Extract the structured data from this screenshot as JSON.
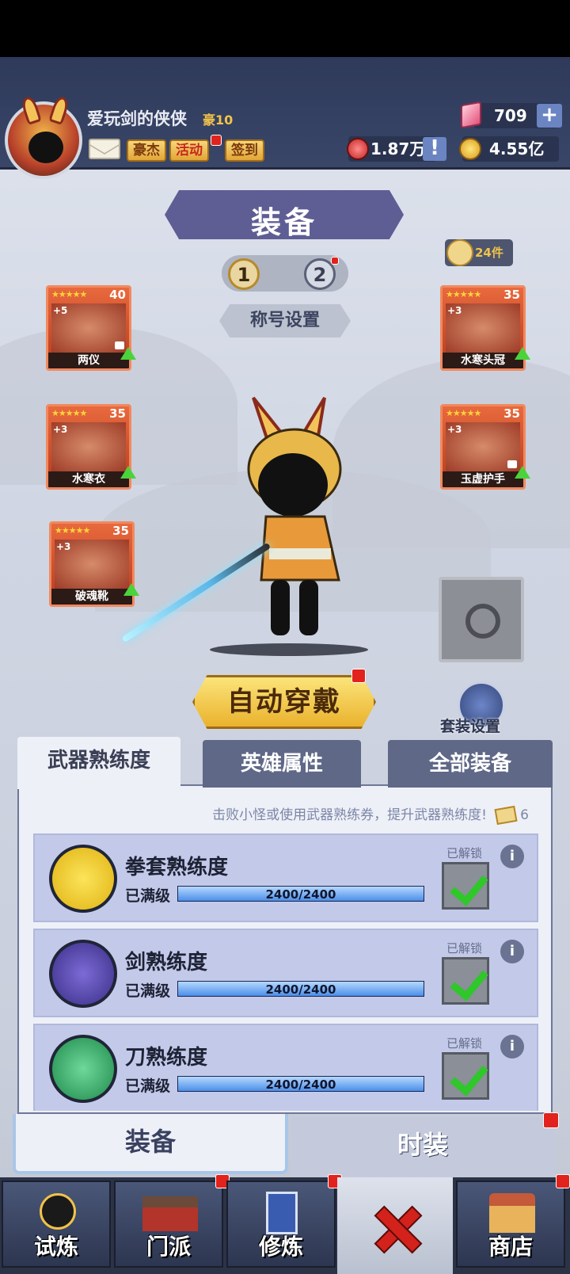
{
  "header": {
    "player_name": "爱玩剑的侠侠",
    "vip_label": "豪10",
    "buttons": [
      "豪杰",
      "活动",
      "签到"
    ],
    "gems": "709",
    "vouchers": "1.87万",
    "coins": "4.55亿",
    "plus_symbol": "+",
    "exclaim_symbol": "!"
  },
  "title": "装备",
  "pager": [
    "1",
    "2"
  ],
  "item_count": "24件",
  "title_setting": "称号设置",
  "slots": [
    {
      "name": "两仪",
      "stars": "★★★★★",
      "level": "40",
      "plus": "+5"
    },
    {
      "name": "水寒衣",
      "stars": "★★★★★",
      "level": "35",
      "plus": "+3"
    },
    {
      "name": "破魂靴",
      "stars": "★★★★★",
      "level": "35",
      "plus": "+3"
    },
    {
      "name": "水寒头冠",
      "stars": "★★★★★",
      "level": "35",
      "plus": "+3"
    },
    {
      "name": "玉虚护手",
      "stars": "★★★★★",
      "level": "35",
      "plus": "+3"
    }
  ],
  "auto_equip": "自动穿戴",
  "suit_setting": "套装设置",
  "panel": {
    "tabs": [
      "武器熟练度",
      "英雄属性",
      "全部装备"
    ],
    "hint": "击败小怪或使用武器熟练券，提升武器熟练度!",
    "ticket_count": "6",
    "rows": [
      {
        "title": "拳套熟练度",
        "status": "已满级",
        "progress": "2400/2400",
        "fraction": 1.0,
        "unlock": "已解锁",
        "info": "i"
      },
      {
        "title": "剑熟练度",
        "status": "已满级",
        "progress": "2400/2400",
        "fraction": 1.0,
        "unlock": "已解锁",
        "info": "i"
      },
      {
        "title": "刀熟练度",
        "status": "已满级",
        "progress": "2400/2400",
        "fraction": 1.0,
        "unlock": "已解锁",
        "info": "i"
      }
    ]
  },
  "lower_tabs": [
    "装备",
    "时装"
  ],
  "nav": [
    "试炼",
    "门派",
    "修炼",
    "商店"
  ],
  "colors": {
    "accent": "#5e5d94",
    "slot_orange": "#e8693d",
    "badge_red": "#e2221c",
    "gold": "#eab22d"
  }
}
